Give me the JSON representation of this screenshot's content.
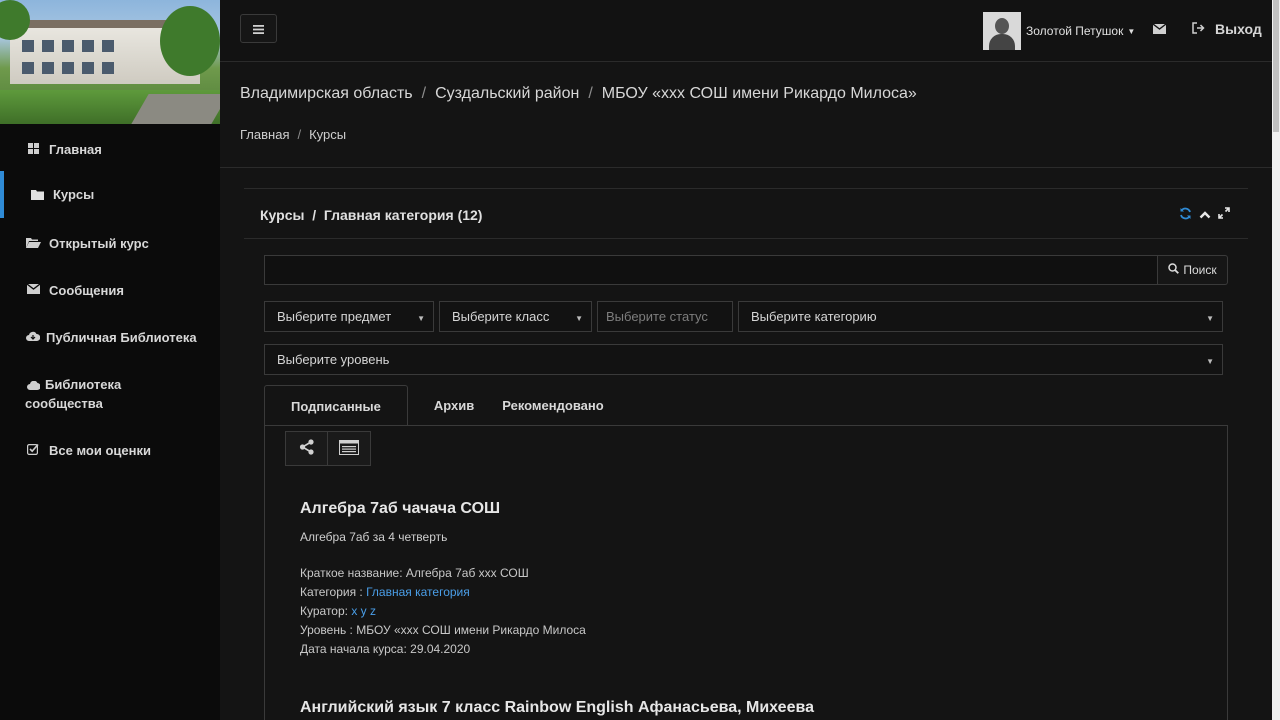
{
  "sidebar": {
    "items": [
      {
        "label": "Главная",
        "icon": "grid-icon"
      },
      {
        "label": "Курсы",
        "icon": "folder-icon"
      },
      {
        "label": "Открытый курс",
        "icon": "folder-open-icon"
      },
      {
        "label": "Сообщения",
        "icon": "envelope-icon"
      },
      {
        "label": "Публичная Библиотека",
        "icon": "cloud-download-icon"
      },
      {
        "label": "Библиотека сообщества",
        "icon": "cloud-icon"
      },
      {
        "label": "Все мои оценки",
        "icon": "check-square-icon"
      }
    ],
    "active_index": 1
  },
  "topbar": {
    "user_name": "Золотой Петушок",
    "logout_label": "Выход"
  },
  "org_breadcrumb": [
    "Владимирская область",
    "Суздальский район",
    "МБОУ «ххх СОШ имени Рикардо Милоса»"
  ],
  "nav_breadcrumb": [
    "Главная",
    "Курсы"
  ],
  "panel": {
    "title": "Курсы  /  Главная категория (12)"
  },
  "search": {
    "value": "",
    "button_label": "Поиск"
  },
  "filters": {
    "subject": "Выберите предмет",
    "class": "Выберите класс",
    "status_placeholder": "Выберите статус",
    "category": "Выберите категорию",
    "level": "Выберите уровень"
  },
  "tabs": [
    "Подписанные",
    "Архив",
    "Рекомендовано"
  ],
  "courses": [
    {
      "title": "Алгебра 7аб чачача СОШ",
      "subtitle": "Алгебра 7аб за 4 четверть",
      "short_name": "Краткое название: Алгебра 7аб ххх СОШ",
      "category_label": "Категория : ",
      "category_link": "Главная категория",
      "curator_label": "Куратор: ",
      "curator_link": "x y z",
      "level": "Уровень : МБОУ «ххх СОШ имени Рикардо Милоса",
      "start_date": "Дата начала курса: 29.04.2020"
    },
    {
      "title": "Английский язык 7 класс Rainbow English Афанасьева, Михеева"
    }
  ],
  "colors": {
    "accent": "#2f8bd6",
    "link": "#4a9ee8",
    "background": "#141414"
  }
}
